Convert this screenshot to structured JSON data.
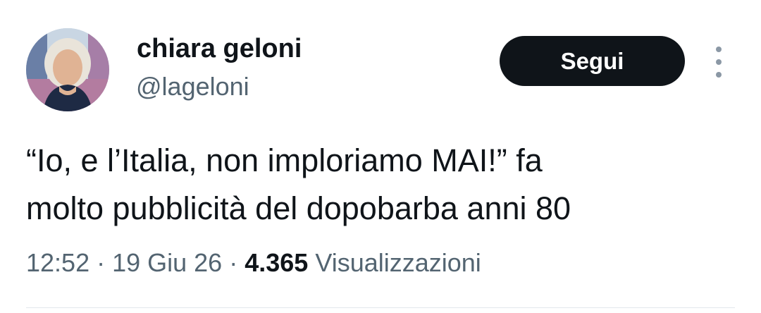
{
  "author": {
    "display_name": "chiara geloni",
    "handle": "@lageloni",
    "avatar_icon": "profile-photo"
  },
  "actions": {
    "follow_label": "Segui",
    "more_icon": "more-vertical-icon"
  },
  "tweet": {
    "lines": [
      "“Io, e l’Italia, non imploriamo MAI!” fa",
      "molto pubblicità del dopobarba anni 80"
    ]
  },
  "meta": {
    "time": "12:52",
    "separator": " · ",
    "date": "19 Giu 26",
    "views_count": "4.365",
    "views_label": "Visualizzazioni"
  },
  "colors": {
    "text_primary": "#0f1419",
    "text_secondary": "#536471",
    "button_bg": "#0f1419",
    "button_text": "#ffffff"
  }
}
